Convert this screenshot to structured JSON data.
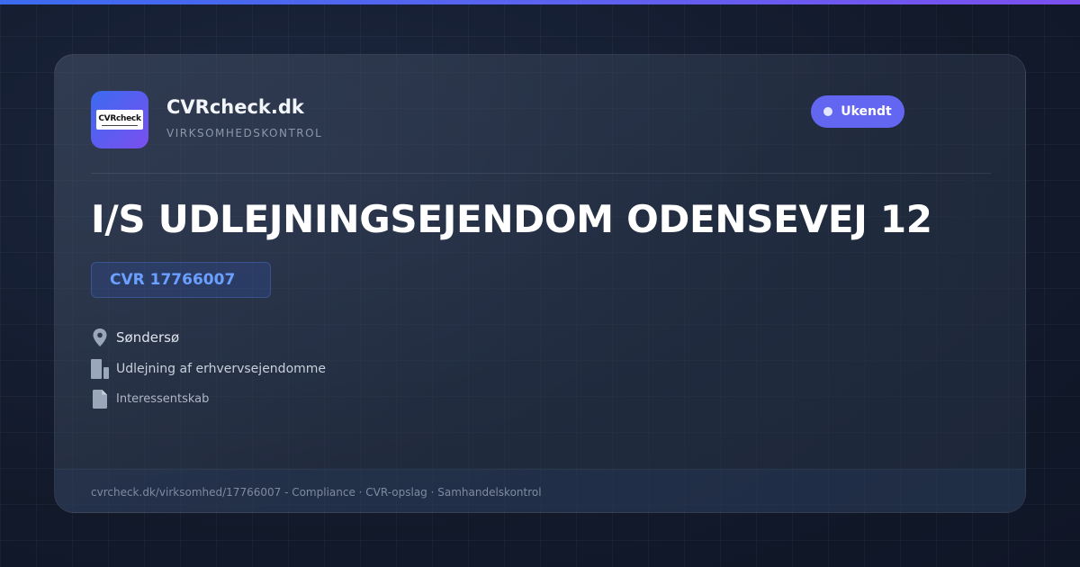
{
  "brand": {
    "logo_text": "CVRcheck",
    "name": "CVRcheck.dk",
    "tagline": "VIRKSOMHEDSKONTROL"
  },
  "status": {
    "label": "Ukendt"
  },
  "company": {
    "name": "I/S UDLEJNINGSEJENDOM ODENSEVEJ 12",
    "cvr": "CVR 17766007",
    "location": "Søndersø",
    "industry": "Udlejning af erhvervsejendomme",
    "type": "Interessentskab"
  },
  "footer": {
    "text": "cvrcheck.dk/virksomhed/17766007 - Compliance · CVR-opslag · Samhandelskontrol"
  },
  "icons": {
    "location": "map-pin-icon",
    "industry": "building-icon",
    "type": "document-icon"
  },
  "colors": {
    "accent": "#6366f1",
    "cvr": "#6aa0ff",
    "gradient_start": "#3b6bf0",
    "gradient_end": "#7c4ff0"
  }
}
